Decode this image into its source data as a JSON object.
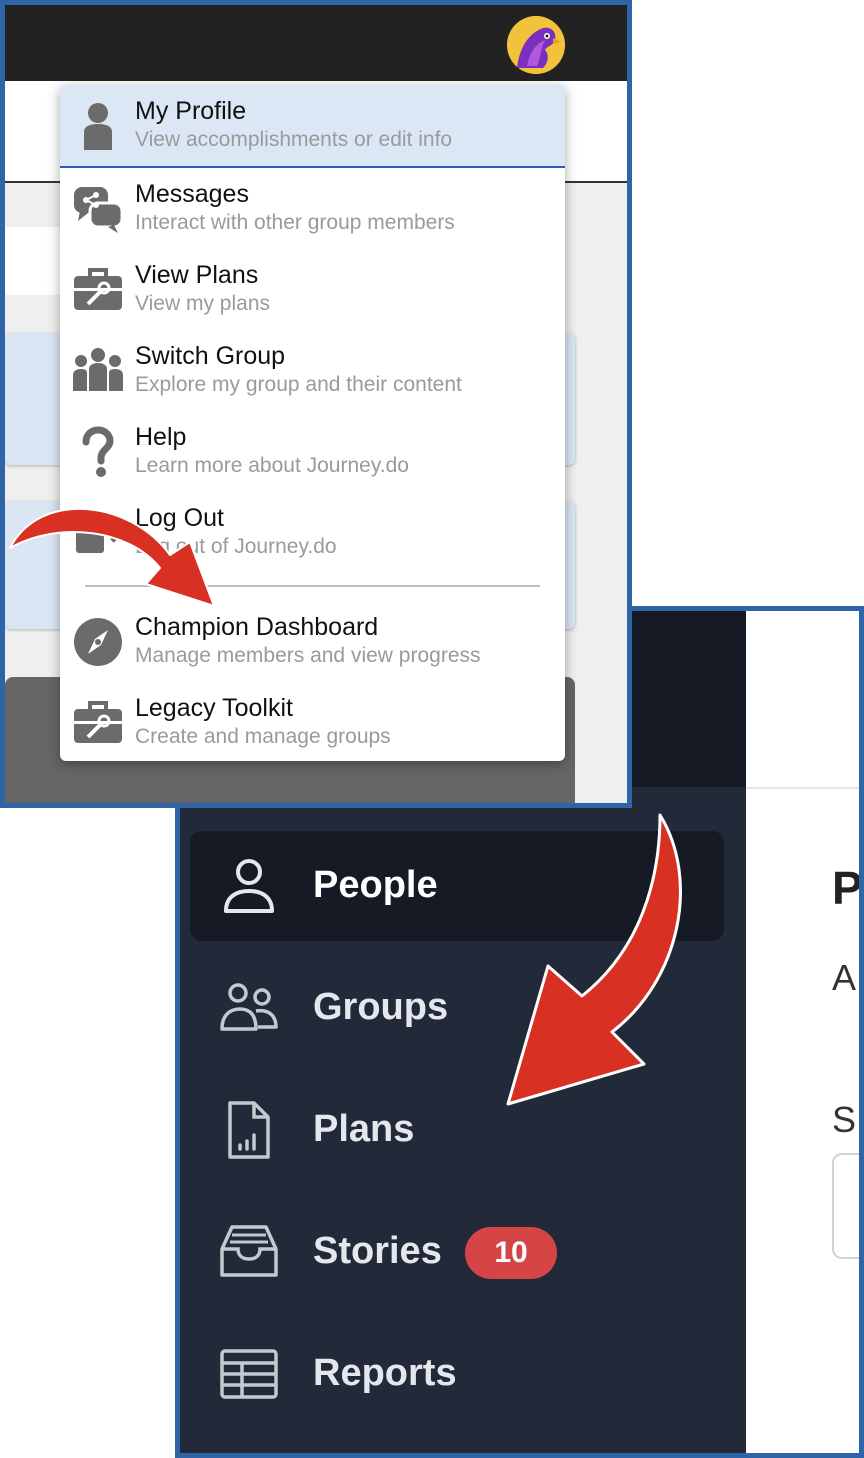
{
  "menu": {
    "items": [
      {
        "icon": "person-icon",
        "title": "My Profile",
        "subtitle": "View accomplishments or edit info"
      },
      {
        "icon": "messages-icon",
        "title": "Messages",
        "subtitle": "Interact with other group members"
      },
      {
        "icon": "toolbox-icon",
        "title": "View Plans",
        "subtitle": "View my plans"
      },
      {
        "icon": "group-icon",
        "title": "Switch Group",
        "subtitle": "Explore my group and their content"
      },
      {
        "icon": "question-icon",
        "title": "Help",
        "subtitle": "Learn more about Journey.do"
      },
      {
        "icon": "logout-icon",
        "title": "Log Out",
        "subtitle": "Log out of Journey.do"
      },
      {
        "icon": "compass-icon",
        "title": "Champion Dashboard",
        "subtitle": "Manage members and view progress"
      },
      {
        "icon": "toolbox-icon",
        "title": "Legacy Toolkit",
        "subtitle": "Create and manage groups"
      }
    ]
  },
  "sidebar": {
    "items": [
      {
        "icon": "user-icon",
        "label": "People",
        "active": true
      },
      {
        "icon": "users-icon",
        "label": "Groups"
      },
      {
        "icon": "document-chart-icon",
        "label": "Plans"
      },
      {
        "icon": "inbox-icon",
        "label": "Stories",
        "badge": "10"
      },
      {
        "icon": "table-icon",
        "label": "Reports"
      }
    ]
  },
  "main": {
    "heading_fragment": "P",
    "subtext_fragment": "A",
    "label_fragment": "S"
  },
  "colors": {
    "frame_border": "#2f64a8",
    "menu_active_bg": "#dce7f5",
    "sidebar_bg": "#222938",
    "sidebar_active_bg": "#151a24",
    "badge_bg": "#d64545",
    "arrow_red": "#d93024"
  }
}
